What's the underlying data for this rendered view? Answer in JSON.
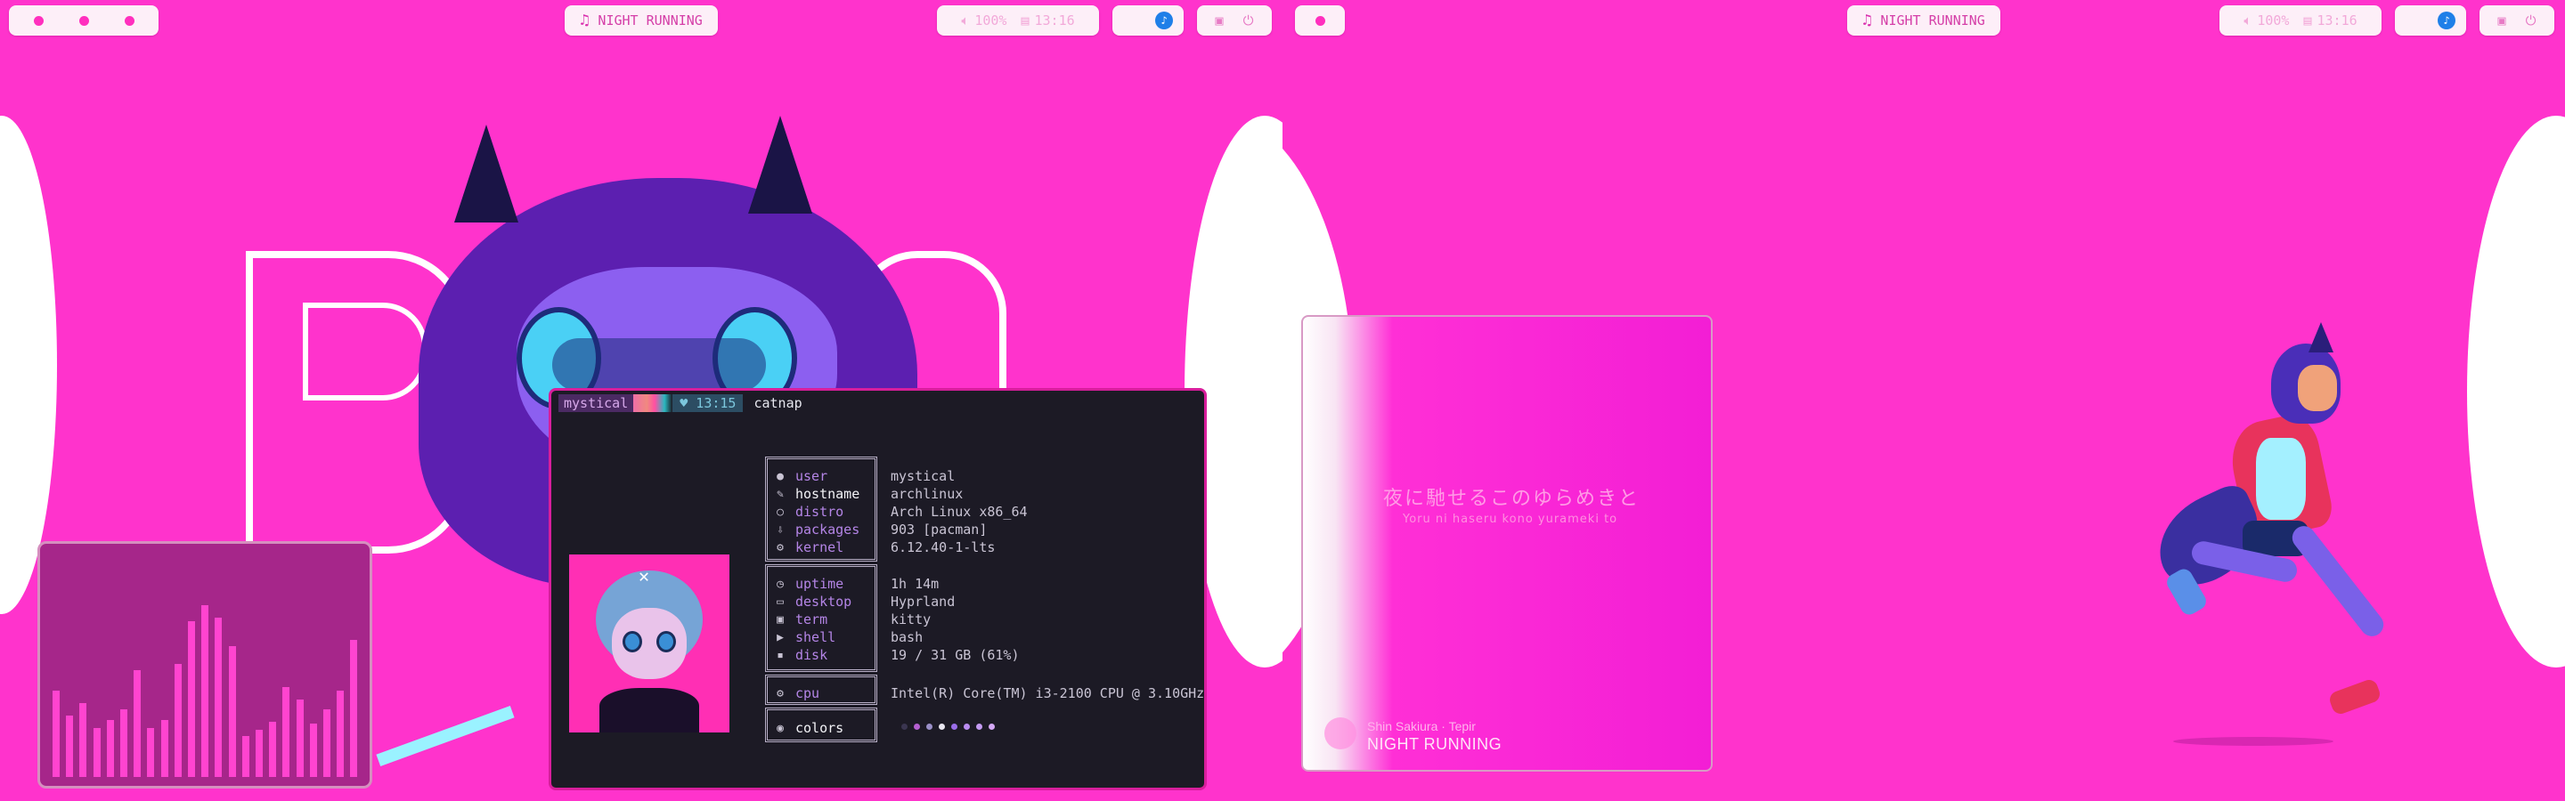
{
  "left_bar": {
    "workspaces": [
      "ws1",
      "ws2",
      "ws3"
    ],
    "media_title": "NIGHT RUNNING",
    "volume": "100%",
    "clock": "13:16"
  },
  "right_bar": {
    "media_title": "NIGHT RUNNING",
    "volume": "100%",
    "clock": "13:16"
  },
  "terminal": {
    "prompt_user": "mystical",
    "prompt_time": "♥ 13:15",
    "command": "catnap",
    "sections": [
      {
        "rows": [
          {
            "icon": "user-icon",
            "key": "user",
            "value": "mystical",
            "highlight": false
          },
          {
            "icon": "hostname-icon",
            "key": "hostname",
            "value": "archlinux",
            "highlight": true
          },
          {
            "icon": "distro-icon",
            "key": "distro",
            "value": "Arch Linux x86_64",
            "highlight": false
          },
          {
            "icon": "packages-icon",
            "key": "packages",
            "value": "903 [pacman]",
            "highlight": false
          },
          {
            "icon": "kernel-icon",
            "key": "kernel",
            "value": "6.12.40-1-lts",
            "highlight": false
          }
        ]
      },
      {
        "rows": [
          {
            "icon": "uptime-icon",
            "key": "uptime",
            "value": "1h 14m",
            "highlight": false
          },
          {
            "icon": "desktop-icon",
            "key": "desktop",
            "value": "Hyprland",
            "highlight": false
          },
          {
            "icon": "term-icon",
            "key": "term",
            "value": "kitty",
            "highlight": false
          },
          {
            "icon": "shell-icon",
            "key": "shell",
            "value": "bash",
            "highlight": false
          },
          {
            "icon": "disk-icon",
            "key": "disk",
            "value": "19 / 31 GB (61%)",
            "highlight": false
          }
        ]
      },
      {
        "rows": [
          {
            "icon": "cpu-icon",
            "key": "cpu",
            "value": "Intel(R) Core(TM) i3-2100 CPU @ 3.10GHz",
            "highlight": false
          }
        ]
      },
      {
        "rows": [
          {
            "icon": "colors-icon",
            "key": "colors",
            "value": "",
            "highlight": true
          }
        ]
      }
    ],
    "palette": [
      "#3a3550",
      "#b45fd0",
      "#9a8fc8",
      "#e8e6f0",
      "#9a6de8",
      "#b98bf0",
      "#c39af2",
      "#d4a8f5"
    ]
  },
  "album": {
    "lyric_jp": "夜に馳せるこのゆらめきと",
    "lyric_romaji": "Yoru ni haseru kono yurameki to",
    "artist": "Shin Sakiura · Tepir",
    "title": "NIGHT RUNNING"
  },
  "visualizer": {
    "levels": [
      0.42,
      0.3,
      0.36,
      0.24,
      0.28,
      0.33,
      0.52,
      0.24,
      0.28,
      0.55,
      0.76,
      0.84,
      0.78,
      0.64,
      0.2,
      0.23,
      0.27,
      0.44,
      0.38,
      0.26,
      0.33,
      0.42,
      0.67
    ]
  },
  "colors": {
    "wallpaper": "#ff33cc",
    "bar_bg": "#fdeff8",
    "accent": "#d53fa8",
    "terminal_bg": "#1c1a25",
    "terminal_border": "#d81e9c"
  }
}
